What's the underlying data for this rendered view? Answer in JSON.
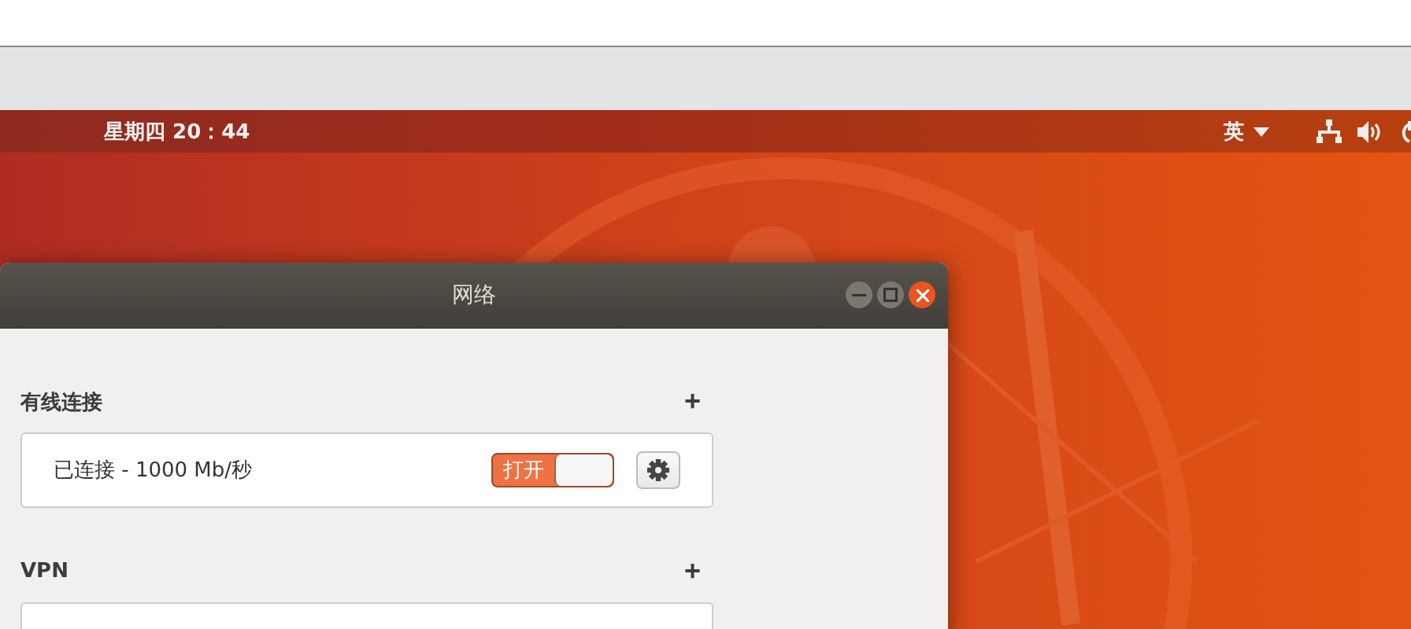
{
  "top_bar": {
    "clock": "星期四 20：44",
    "input_method": "英"
  },
  "window": {
    "title": "网络"
  },
  "sections": [
    {
      "title": "有线连接",
      "add": "+",
      "rows": [
        {
          "label": "已连接 - 1000 Mb/秒",
          "switch": {
            "label": "打开",
            "on": true
          }
        }
      ]
    },
    {
      "title": "VPN",
      "add": "+"
    }
  ]
}
